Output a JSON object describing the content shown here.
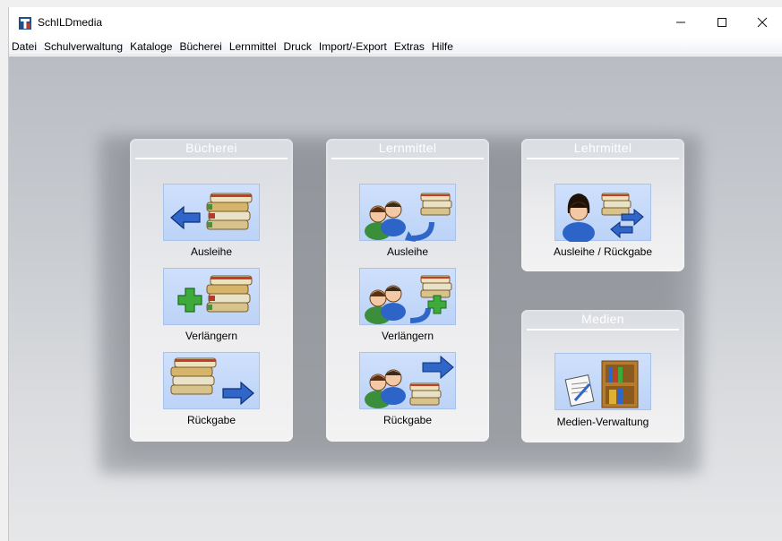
{
  "window": {
    "title": "SchILDmedia",
    "controls": {
      "minimize": "—",
      "maximize": "☐",
      "close": "✕"
    }
  },
  "menu": [
    "Datei",
    "Schulverwaltung",
    "Kataloge",
    "Bücherei",
    "Lernmittel",
    "Druck",
    "Import/-Export",
    "Extras",
    "Hilfe"
  ],
  "panels": {
    "buecherei": {
      "title": "Bücherei",
      "items": [
        {
          "label": "Ausleihe",
          "icon": "books-arrow-left-icon"
        },
        {
          "label": "Verlängern",
          "icon": "books-plus-icon"
        },
        {
          "label": "Rückgabe",
          "icon": "books-arrow-right-icon"
        }
      ]
    },
    "lernmittel": {
      "title": "Lernmittel",
      "items": [
        {
          "label": "Ausleihe",
          "icon": "people-books-return-icon"
        },
        {
          "label": "Verlängern",
          "icon": "people-books-plus-icon"
        },
        {
          "label": "Rückgabe",
          "icon": "people-books-arrow-icon"
        }
      ]
    },
    "lehrmittel": {
      "title": "Lehrmittel",
      "items": [
        {
          "label": "Ausleihe / Rückgabe",
          "icon": "teacher-books-exchange-icon"
        }
      ]
    },
    "medien": {
      "title": "Medien",
      "items": [
        {
          "label": "Medien-Verwaltung",
          "icon": "document-shelf-icon"
        }
      ]
    }
  }
}
